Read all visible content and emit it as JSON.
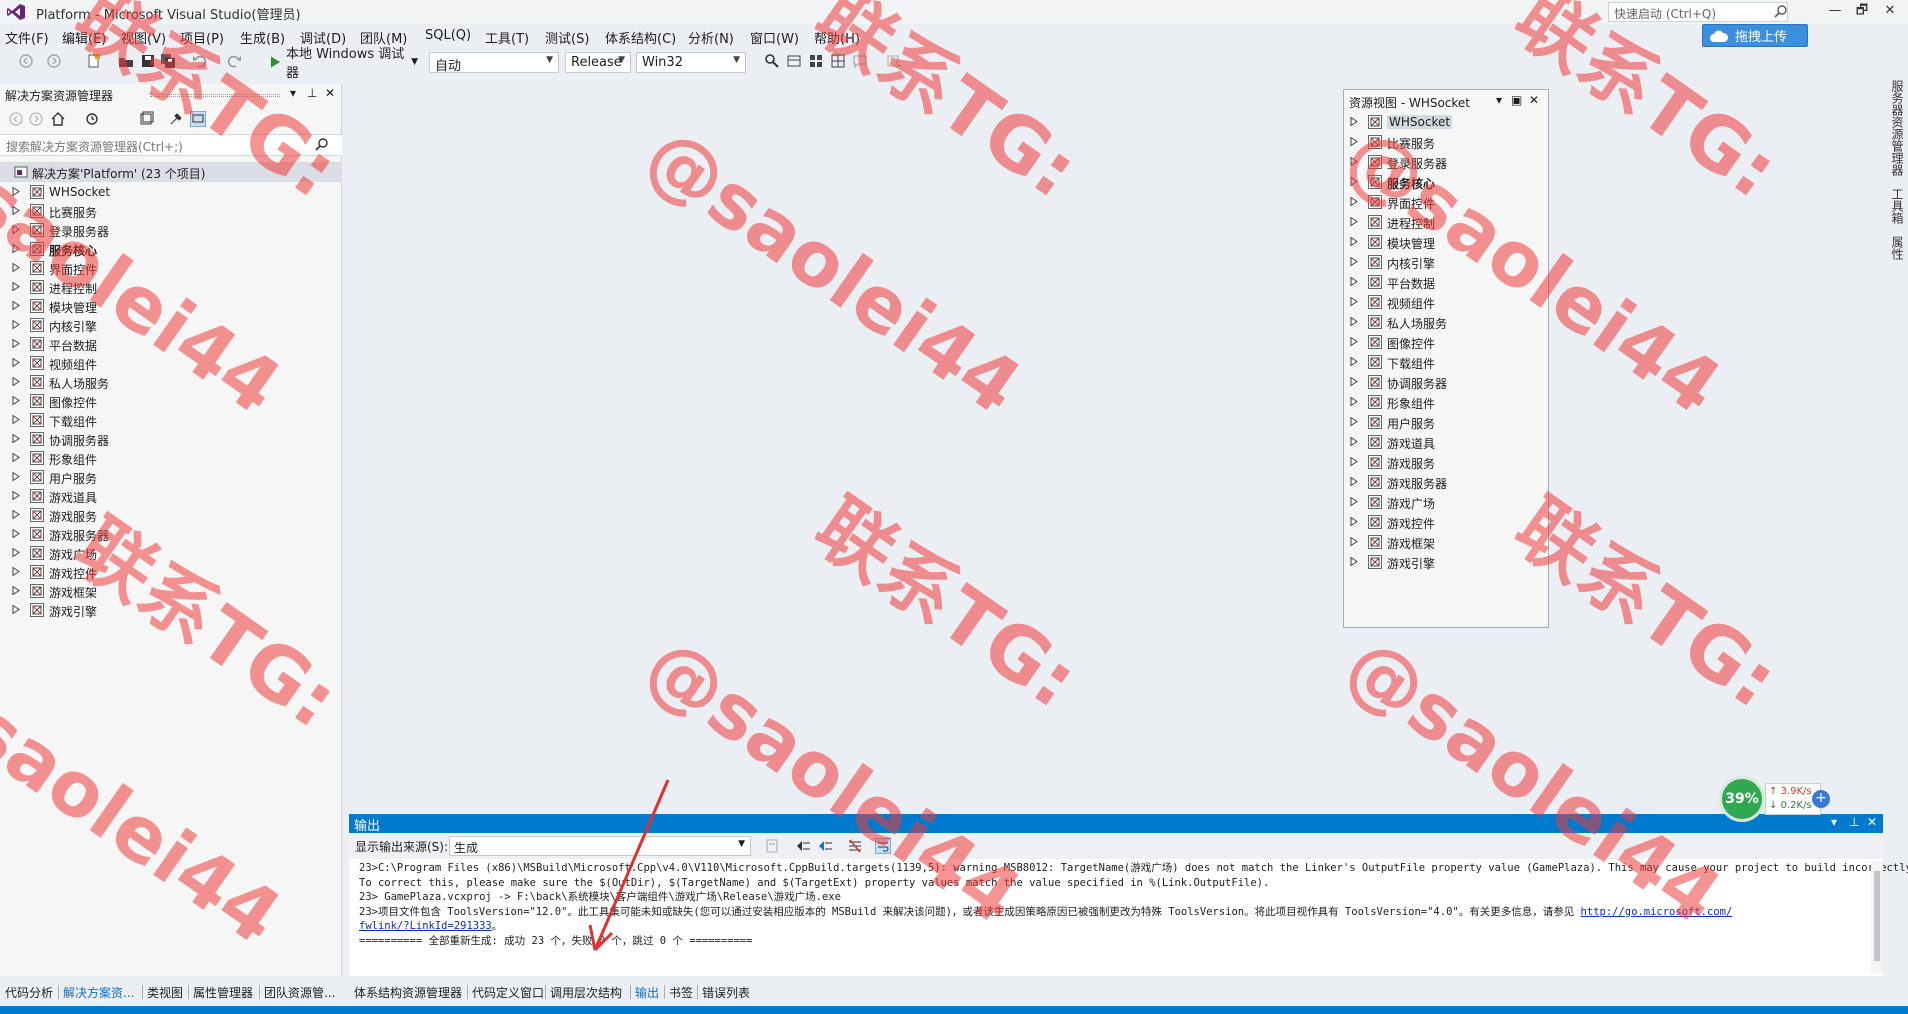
{
  "title": "Platform - Microsoft Visual Studio(管理员)",
  "quick_launch_placeholder": "快速启动 (Ctrl+Q)",
  "window_controls": {
    "minimize": "—",
    "maximize": "🗗",
    "close": "✕"
  },
  "menu": [
    "文件(F)",
    "编辑(E)",
    "视图(V)",
    "项目(P)",
    "生成(B)",
    "调试(D)",
    "团队(M)",
    "SQL(Q)",
    "工具(T)",
    "测试(S)",
    "体系结构(C)",
    "分析(N)",
    "窗口(W)",
    "帮助(H)"
  ],
  "toolbar": {
    "run_label": "本地 Windows 调试器",
    "combo_mode": "自动",
    "combo_config": "Release",
    "combo_platform": "Win32",
    "upload_label": "拖拽上传"
  },
  "right_strip": {
    "tab1": "服务器资源管理器",
    "tab2": "工具箱",
    "tab3": "属性"
  },
  "solution_explorer": {
    "title": "解决方案资源管理器",
    "search_placeholder": "搜索解决方案资源管理器(Ctrl+;)",
    "root": "解决方案'Platform' (23 个项目)",
    "items": [
      {
        "label": "WHSocket",
        "bold": false
      },
      {
        "label": "比赛服务",
        "bold": false
      },
      {
        "label": "登录服务器",
        "bold": false
      },
      {
        "label": "服务核心",
        "bold": true
      },
      {
        "label": "界面控件",
        "bold": false
      },
      {
        "label": "进程控制",
        "bold": false
      },
      {
        "label": "模块管理",
        "bold": false
      },
      {
        "label": "内核引擎",
        "bold": false
      },
      {
        "label": "平台数据",
        "bold": false
      },
      {
        "label": "视频组件",
        "bold": false
      },
      {
        "label": "私人场服务",
        "bold": false
      },
      {
        "label": "图像控件",
        "bold": false
      },
      {
        "label": "下载组件",
        "bold": false
      },
      {
        "label": "协调服务器",
        "bold": false
      },
      {
        "label": "形象组件",
        "bold": false
      },
      {
        "label": "用户服务",
        "bold": false
      },
      {
        "label": "游戏道具",
        "bold": false
      },
      {
        "label": "游戏服务",
        "bold": false
      },
      {
        "label": "游戏服务器",
        "bold": false
      },
      {
        "label": "游戏广场",
        "bold": false
      },
      {
        "label": "游戏控件",
        "bold": false
      },
      {
        "label": "游戏框架",
        "bold": false
      },
      {
        "label": "游戏引擎",
        "bold": false
      }
    ]
  },
  "resource_view": {
    "title": "资源视图 - WHSocket",
    "items": [
      {
        "label": "WHSocket",
        "bold": false,
        "selected": true
      },
      {
        "label": "比赛服务",
        "bold": false
      },
      {
        "label": "登录服务器",
        "bold": false
      },
      {
        "label": "服务核心",
        "bold": true
      },
      {
        "label": "界面控件",
        "bold": false
      },
      {
        "label": "进程控制",
        "bold": false
      },
      {
        "label": "模块管理",
        "bold": false
      },
      {
        "label": "内核引擎",
        "bold": false
      },
      {
        "label": "平台数据",
        "bold": false
      },
      {
        "label": "视频组件",
        "bold": false
      },
      {
        "label": "私人场服务",
        "bold": false
      },
      {
        "label": "图像控件",
        "bold": false
      },
      {
        "label": "下载组件",
        "bold": false
      },
      {
        "label": "协调服务器",
        "bold": false
      },
      {
        "label": "形象组件",
        "bold": false
      },
      {
        "label": "用户服务",
        "bold": false
      },
      {
        "label": "游戏道具",
        "bold": false
      },
      {
        "label": "游戏服务",
        "bold": false
      },
      {
        "label": "游戏服务器",
        "bold": false
      },
      {
        "label": "游戏广场",
        "bold": false
      },
      {
        "label": "游戏控件",
        "bold": false
      },
      {
        "label": "游戏框架",
        "bold": false
      },
      {
        "label": "游戏引擎",
        "bold": false
      }
    ]
  },
  "output": {
    "title": "输出",
    "source_label": "显示输出来源(S):",
    "source_value": "生成",
    "lines": [
      "23>C:\\Program Files (x86)\\MSBuild\\Microsoft.Cpp\\v4.0\\V110\\Microsoft.CppBuild.targets(1139,5): warning MSB8012: TargetName(游戏广场) does not match the Linker's OutputFile property value (GamePlaza). This may cause your project to build incorrectly.",
      "To correct this, please make sure the $(OutDir), $(TargetName) and $(TargetExt) property values match the value specified in %(Link.OutputFile).",
      "23>  GamePlaza.vcxproj -> F:\\back\\系统模块\\客户端组件\\游戏广场\\Release\\游戏广场.exe",
      "23>项目文件包含 ToolsVersion=\"12.0\"。此工具集可能未知或缺失(您可以通过安装相应版本的 MSBuild 来解决该问题)，或者该生成因策略原因已被强制更改为特殊 ToolsVersion。将此项目视作具有 ToolsVersion=\"4.0\"。有关更多信息，请参见 ",
      "http://go.microsoft.com/",
      "fwlink/?LinkId=291333",
      "。",
      "========== 全部重新生成: 成功 23 个，失败 0 个，跳过 0 个 =========="
    ]
  },
  "bottom_tabs_left": [
    "代码分析",
    "解决方案资...",
    "类视图",
    "属性管理器",
    "团队资源管..."
  ],
  "bottom_tabs_right": [
    "体系结构资源管理器",
    "代码定义窗口",
    "调用层次结构",
    "输出",
    "书签",
    "错误列表"
  ],
  "net_monitor": {
    "percent": "39%",
    "up": "3.9K/s",
    "down": "0.2K/s",
    "plus": "+"
  },
  "watermark": {
    "line1": "联系TG:",
    "line2": "@saolei44"
  },
  "colors": {
    "accent": "#007acc",
    "watermark": "#ee3b3b",
    "upload_button": "#3b8fdc",
    "net_circle": "#2fa84f"
  }
}
